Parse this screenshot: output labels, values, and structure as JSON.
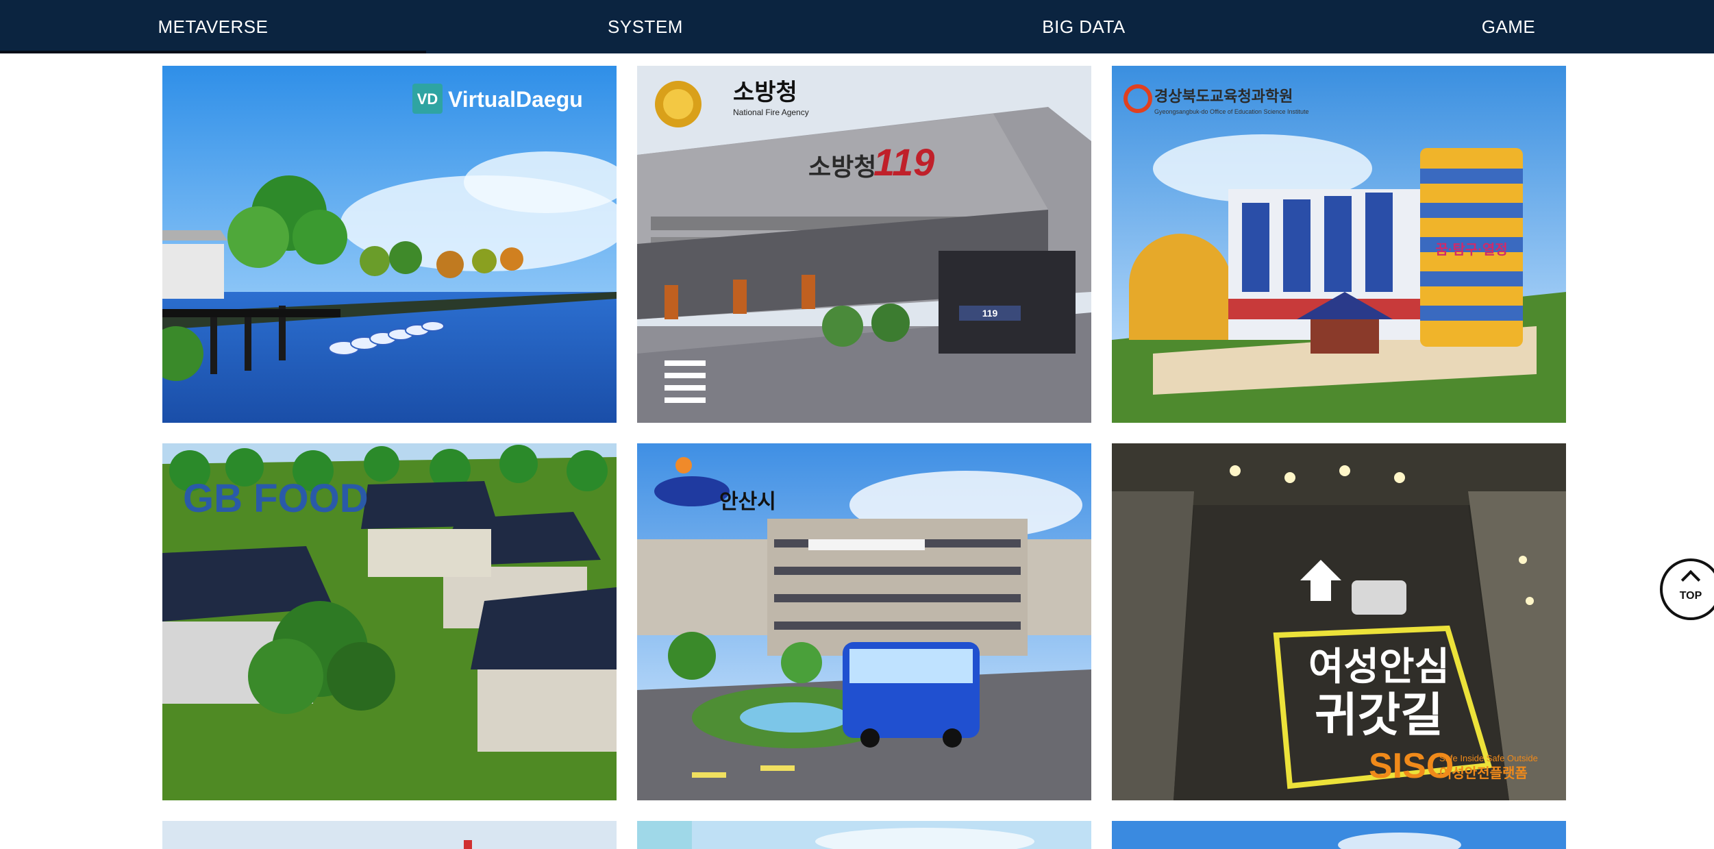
{
  "nav": {
    "tabs": [
      "METAVERSE",
      "SYSTEM",
      "BIG DATA",
      "GAME"
    ],
    "active_index": 0
  },
  "cards": {
    "virtualdaegu": {
      "logo_badge": "VD",
      "logo_text": "VirtualDaegu"
    },
    "fire_agency": {
      "logo_text": "소방청",
      "logo_sub": "National Fire Agency",
      "building_sign": "소방청",
      "building_number": "119",
      "entrance_sign": "119"
    },
    "gyeongbuk_edu": {
      "logo_text": "경상북도교육청과학원",
      "logo_sub": "Gyeongsangbuk-do Office of Education Science Institute",
      "tower_sign": "꿈·탐구·열정"
    },
    "gb_food": {
      "logo_text": "GB FOOD"
    },
    "ansan": {
      "logo_text": "안산시"
    },
    "siso": {
      "road_text_line1": "여성안심",
      "road_text_line2": "귀갓길",
      "brand": "SISO",
      "brand_tag": "Safe Inside Safe Outside",
      "brand_kr": "여성안전플랫폼"
    }
  },
  "top_button": {
    "label": "TOP"
  },
  "colors": {
    "nav_bg": "#0b2440",
    "nav_text": "#ffffff",
    "indicator": "#050d18"
  },
  "icons": {
    "top_button": "chevron-up-icon"
  }
}
